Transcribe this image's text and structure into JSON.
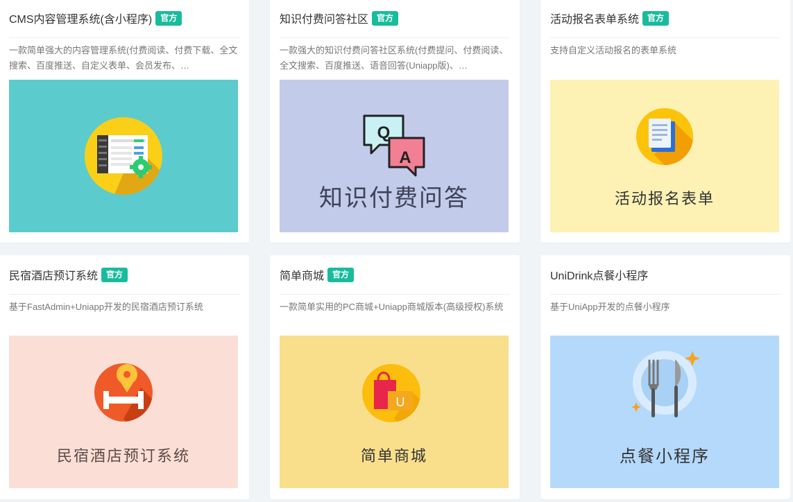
{
  "cards": [
    {
      "title": "CMS内容管理系统(含小程序)",
      "badge": "官方",
      "description": "一款简单强大的内容管理系统(付费阅读、付费下载、全文搜索、百度推送、自定义表单、会员发布、…",
      "banner_text": "",
      "banner_color": "#5ccbcd",
      "icon": "cms-dashboard-icon"
    },
    {
      "title": "知识付费问答社区",
      "badge": "官方",
      "description": "一款强大的知识付费问答社区系统(付费提问、付费阅读、全文搜索、百度推送、语音回答(Uniapp版)、…",
      "banner_text": "知识付费问答",
      "banner_color": "#c3cbea",
      "icon": "qa-bubbles-icon"
    },
    {
      "title": "活动报名表单系统",
      "badge": "官方",
      "description": "支持自定义活动报名的表单系统",
      "banner_text": "活动报名表单",
      "banner_color": "#fdf1b4",
      "icon": "form-document-icon"
    },
    {
      "title": "民宿酒店预订系统",
      "badge": "官方",
      "description": "基于FastAdmin+Uniapp开发的民宿酒店预订系统",
      "banner_text": "民宿酒店预订系统",
      "banner_color": "#fbdfd6",
      "icon": "hotel-bed-pin-icon"
    },
    {
      "title": "简单商城",
      "badge": "官方",
      "description": "一款简单实用的PC商城+Uniapp商城版本(高级授权)系统",
      "banner_text": "简单商城",
      "banner_color": "#f9df8c",
      "icon": "shopping-bag-icon"
    },
    {
      "title": "UniDrink点餐小程序",
      "badge": "",
      "description": "基于UniApp开发的点餐小程序",
      "banner_text": "点餐小程序",
      "banner_color": "#b5d9fb",
      "icon": "fork-knife-plate-icon"
    }
  ]
}
